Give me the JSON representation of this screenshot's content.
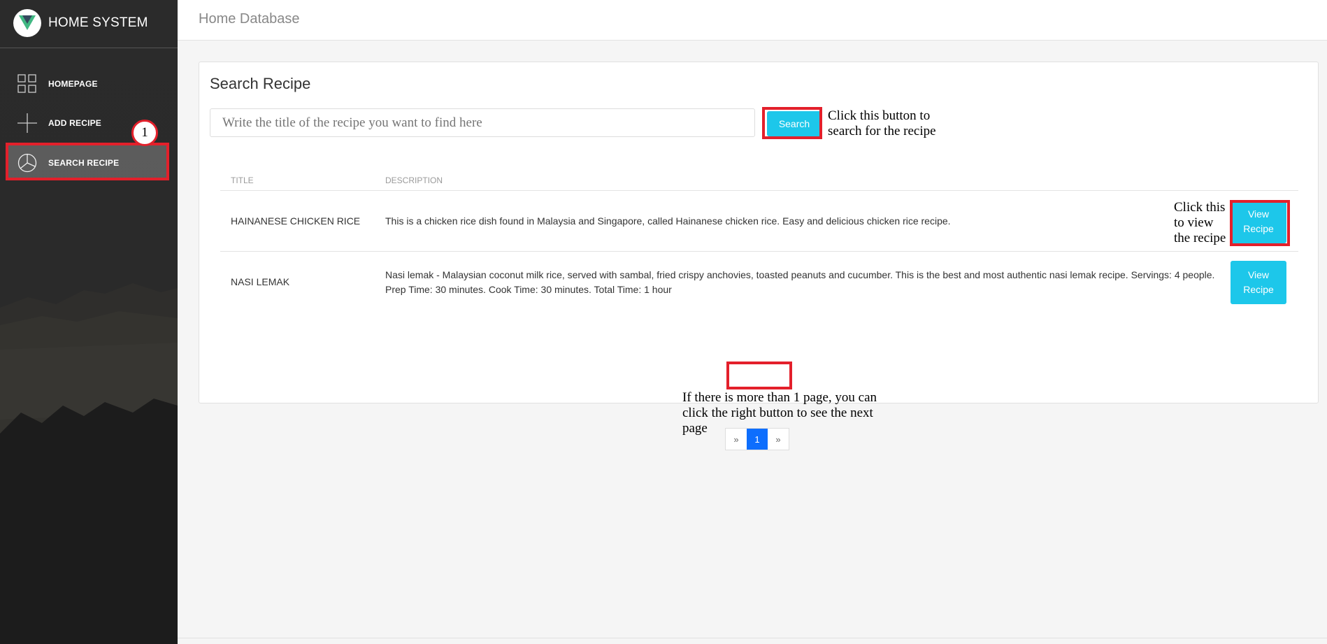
{
  "brand": {
    "title": "HOME SYSTEM",
    "logo_icon": "vue-logo-icon"
  },
  "sidebar": {
    "items": [
      {
        "label": "HOMEPAGE",
        "icon": "grid-icon"
      },
      {
        "label": "ADD RECIPE",
        "icon": "plus-icon"
      },
      {
        "label": "SEARCH RECIPE",
        "icon": "pie-chart-icon",
        "active": true
      }
    ]
  },
  "topbar": {
    "title": "Home Database"
  },
  "main": {
    "card_title": "Search Recipe",
    "search": {
      "placeholder": "Write the title of the recipe you want to find here",
      "button_label": "Search"
    },
    "table": {
      "headers": [
        "TITLE",
        "DESCRIPTION"
      ],
      "rows": [
        {
          "title": "HAINANESE CHICKEN RICE",
          "description": "This is a chicken rice dish found in Malaysia and Singapore, called Hainanese chicken rice. Easy and delicious chicken rice recipe.",
          "button_label": "View Recipe"
        },
        {
          "title": "NASI LEMAK",
          "description": "Nasi lemak - Malaysian coconut milk rice, served with sambal, fried crispy anchovies, toasted peanuts and cucumber. This is the best and most authentic nasi lemak recipe. Servings: 4 people. Prep Time: 30 minutes. Cook Time: 30 minutes. Total Time: 1 hour",
          "button_label": "View Recipe"
        }
      ]
    },
    "pagination": {
      "prev": "»",
      "current": "1",
      "next": "»"
    }
  },
  "annotations": {
    "step_number": "1",
    "search_note": "Click this button to search for the recipe",
    "view_note": "Click this to view the recipe",
    "pagination_note": "If there is more than 1 page, you can click the right button to see the next page"
  },
  "colors": {
    "accent": "#1dc7ea",
    "highlight": "#e3202b",
    "page_active": "#0d6efd"
  }
}
